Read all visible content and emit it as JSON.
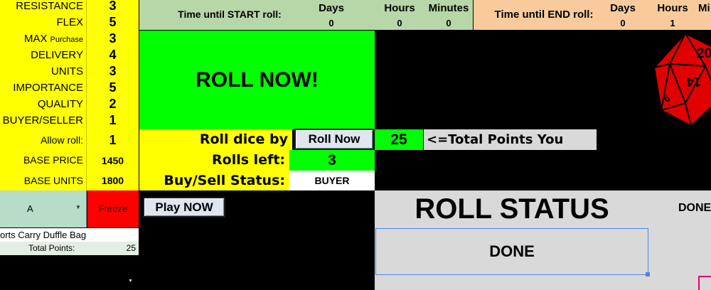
{
  "stats": [
    {
      "label": "RESISTANCE",
      "value": "3"
    },
    {
      "label": "FLEX",
      "value": "5"
    },
    {
      "label": "MAX",
      "small": "Purchase",
      "value": "3"
    },
    {
      "label": "DELIVERY",
      "value": "4"
    },
    {
      "label": "UNITS",
      "value": "3"
    },
    {
      "label": "IMPORTANCE",
      "value": "5"
    },
    {
      "label": "QUALITY",
      "value": "2"
    },
    {
      "label": "BUYER/SELLER",
      "value": "1"
    }
  ],
  "allow_roll": {
    "label": "Allow roll:",
    "value": "1"
  },
  "base_price": {
    "label": "BASE PRICE",
    "value": "1450"
  },
  "base_units": {
    "label": "BASE UNITS",
    "value": "1800"
  },
  "start_timer": {
    "label": "Time until START roll:",
    "days_label": "Days",
    "days": "0",
    "hours_label": "Hours",
    "hours": "0",
    "minutes_label": "Minutes",
    "minutes": "0"
  },
  "end_timer": {
    "label": "Time until END roll:",
    "days_label": "Days",
    "days": "0",
    "hours_label": "Hours",
    "hours": "1",
    "minutes_label": "Mi"
  },
  "roll_now_banner": "ROLL NOW!",
  "roll_dice_label": "Roll dice by clicking:",
  "roll_now_button": "Roll Now",
  "total_points_value": "25",
  "total_points_label": "<=Total Points You Spend",
  "rolls_left_label": "Rolls left:",
  "rolls_left_value": "3",
  "buy_sell_label": "Buy/Sell Status:",
  "buy_sell_value": "BUYER",
  "dropdown_value": "A",
  "freeze_label": "Freeze",
  "play_now_button": "Play NOW",
  "product_name": "orts Carry Duffle Bag",
  "total_points_row_label": "Total Points:",
  "total_points_row_value": "25",
  "roll_status_title": "ROLL STATUS",
  "roll_status_value": "DONE",
  "roll_status_side": "DONE",
  "die": {
    "top": "20",
    "mid": "14",
    "low": "6",
    "icon": "d20-die-icon",
    "color": "#e00000"
  },
  "colors": {
    "yellow": "#ffff00",
    "green": "#00ff00",
    "sage": "#b7d7a8",
    "peach": "#f9cb9c",
    "freeze": "#ff0000"
  }
}
